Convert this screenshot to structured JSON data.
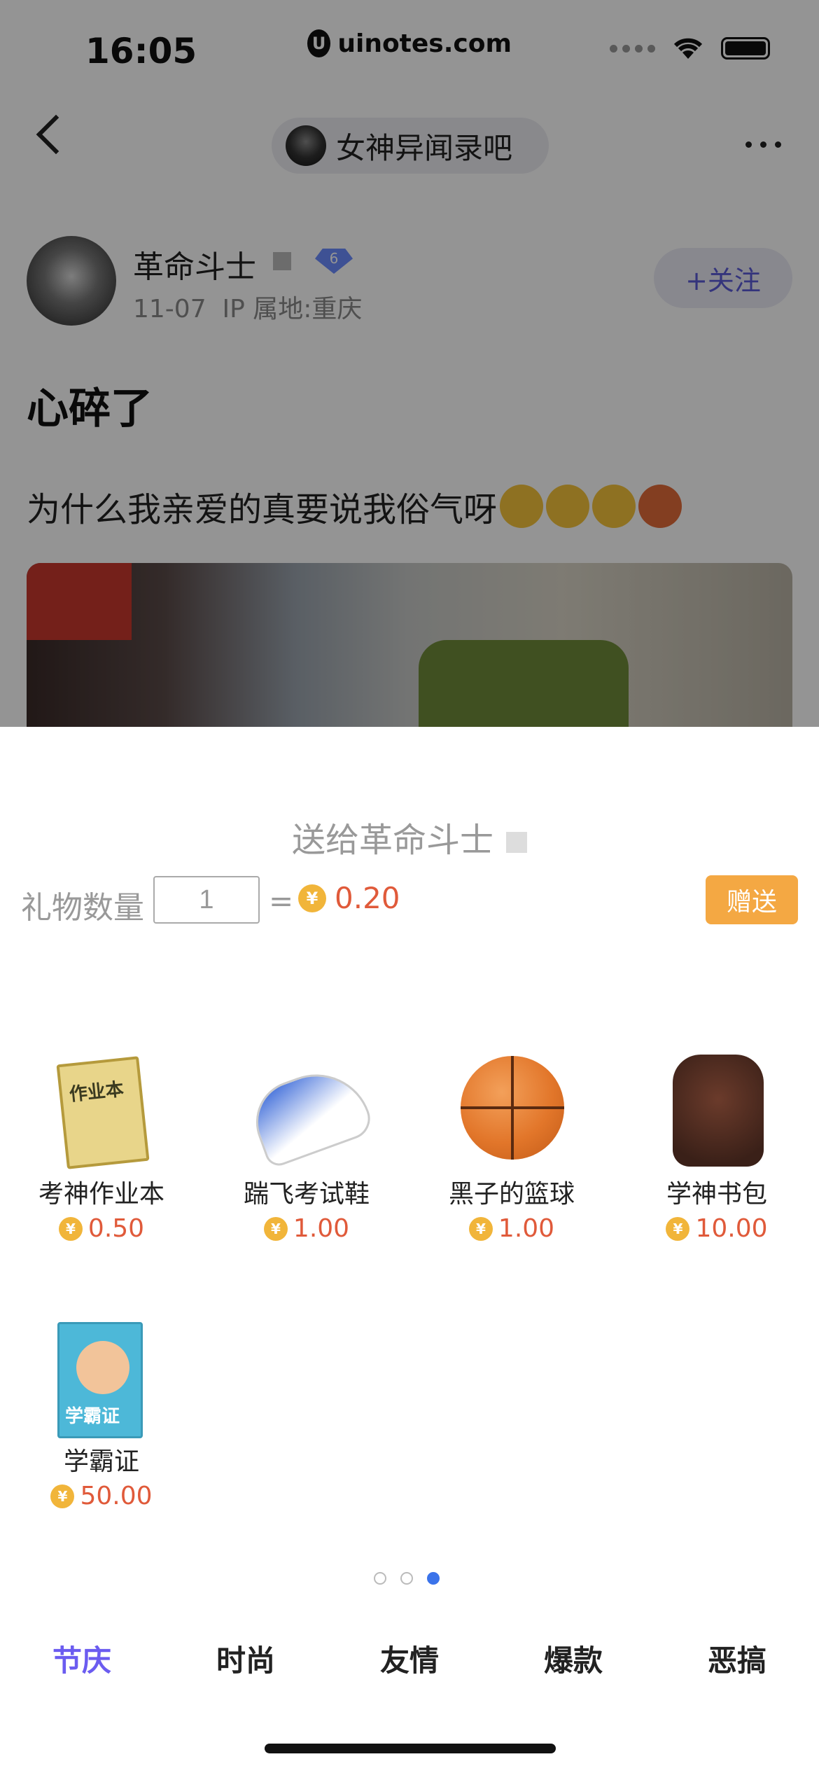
{
  "status_bar": {
    "time": "16:05",
    "url": "uinotes.com"
  },
  "nav": {
    "forum_name": "女神异闻录吧"
  },
  "post": {
    "author": "革命斗士",
    "level": "6",
    "date": "11-07",
    "ip": "IP 属地:重庆",
    "follow_label": "+关注",
    "title": "心碎了",
    "body": "为什么我亲爱的真要说我俗气呀"
  },
  "gift_sheet": {
    "send_to": "送给革命斗士",
    "qty_label": "礼物数量",
    "qty_value": "1",
    "equals": "=",
    "total": "0.20",
    "send_button": "赠送",
    "gifts": [
      {
        "name": "考神作业本",
        "price": "0.50",
        "icon": "exercise-book-icon"
      },
      {
        "name": "踹飞考试鞋",
        "price": "1.00",
        "icon": "sneaker-icon"
      },
      {
        "name": "黑子的篮球",
        "price": "1.00",
        "icon": "basketball-icon"
      },
      {
        "name": "学神书包",
        "price": "10.00",
        "icon": "backpack-icon"
      },
      {
        "name": "学霸证",
        "price": "50.00",
        "icon": "certificate-icon"
      }
    ],
    "page_count": 3,
    "active_page": 3,
    "tabs": [
      "节庆",
      "时尚",
      "友情",
      "爆款",
      "恶搞"
    ],
    "active_tab": "节庆"
  },
  "colors": {
    "accent": "#6b5cf0",
    "price": "#e05a3a",
    "button": "#f4a843",
    "page_dot": "#3b73ea"
  }
}
